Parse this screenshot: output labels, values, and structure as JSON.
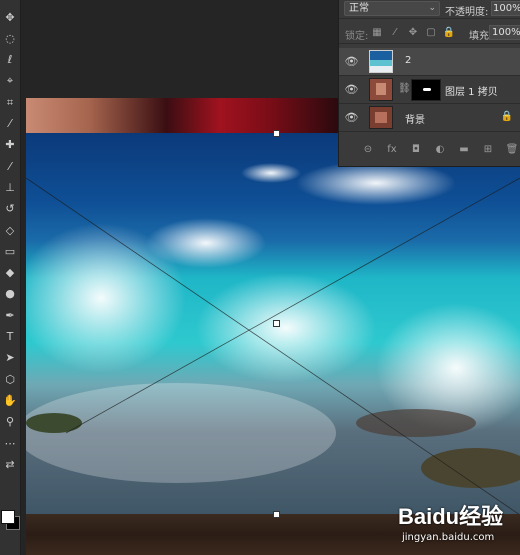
{
  "toolbar": {
    "tools": [
      {
        "name": "move-tool-icon",
        "glyph": "✥"
      },
      {
        "name": "marquee-tool-icon",
        "glyph": "◌"
      },
      {
        "name": "lasso-tool-icon",
        "glyph": "ℓ"
      },
      {
        "name": "quick-select-tool-icon",
        "glyph": "⌖"
      },
      {
        "name": "crop-tool-icon",
        "glyph": "⌗"
      },
      {
        "name": "eyedropper-tool-icon",
        "glyph": "⁄"
      },
      {
        "name": "healing-brush-tool-icon",
        "glyph": "✚"
      },
      {
        "name": "brush-tool-icon",
        "glyph": "⁄"
      },
      {
        "name": "clone-stamp-tool-icon",
        "glyph": "⊥"
      },
      {
        "name": "history-brush-tool-icon",
        "glyph": "↺"
      },
      {
        "name": "eraser-tool-icon",
        "glyph": "◇"
      },
      {
        "name": "gradient-tool-icon",
        "glyph": "▭"
      },
      {
        "name": "blur-tool-icon",
        "glyph": "◆"
      },
      {
        "name": "dodge-tool-icon",
        "glyph": "●"
      },
      {
        "name": "pen-tool-icon",
        "glyph": "✒"
      },
      {
        "name": "type-tool-icon",
        "glyph": "T"
      },
      {
        "name": "path-select-tool-icon",
        "glyph": "➤"
      },
      {
        "name": "shape-tool-icon",
        "glyph": "⬡"
      },
      {
        "name": "hand-tool-icon",
        "glyph": "✋"
      },
      {
        "name": "zoom-tool-icon",
        "glyph": "⚲"
      },
      {
        "name": "more-tools-icon",
        "glyph": "⋯"
      },
      {
        "name": "swap-colors-icon",
        "glyph": "⇄"
      }
    ],
    "colors": {
      "foreground": "#ffffff",
      "background": "#000000"
    }
  },
  "layers_panel": {
    "blend_mode": "正常",
    "opacity_label": "不透明度:",
    "opacity_value": "100%",
    "lock_label": "锁定:",
    "fill_label": "填充:",
    "fill_value": "100%",
    "layers": [
      {
        "name": "2",
        "selected": true
      },
      {
        "name": "图层 1 拷贝",
        "selected": false
      },
      {
        "name": "背景",
        "selected": false,
        "locked": true
      }
    ],
    "footer_icons": [
      "link-layers-icon",
      "fx-icon",
      "add-mask-icon",
      "adjustment-layer-icon",
      "new-group-icon",
      "new-layer-icon",
      "delete-layer-icon"
    ],
    "footer_glyphs": [
      "⊝",
      "fx",
      "◘",
      "◐",
      "▬",
      "⊞",
      "🗑"
    ]
  },
  "watermark": {
    "brand": "Baidu经验",
    "url": "jingyan.baidu.com"
  }
}
